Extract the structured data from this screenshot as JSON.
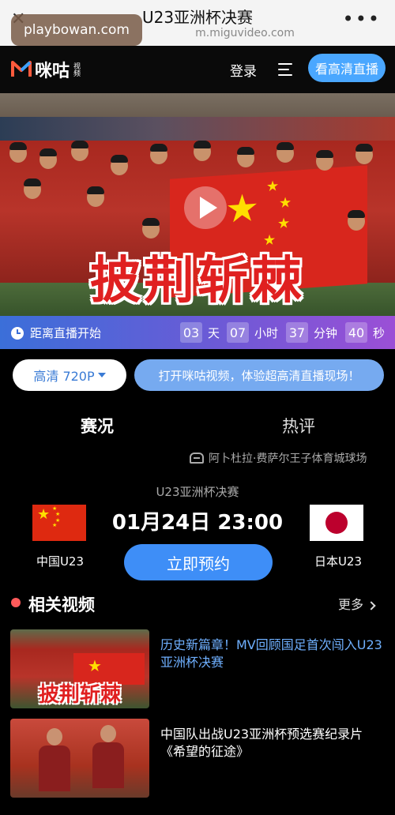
{
  "browser": {
    "title": "U23亚洲杯决赛",
    "url": "m.miguvideo.com",
    "watermark": "playbowan.com"
  },
  "header": {
    "logo_text": "咪咕",
    "logo_sub": "视频",
    "login": "登录",
    "hd_live": "看高清直播"
  },
  "hero": {
    "slogan": "披荆斩棘"
  },
  "countdown": {
    "label": "距离直播开始",
    "days": "03",
    "days_unit": "天",
    "hours": "07",
    "hours_unit": "小时",
    "minutes": "37",
    "minutes_unit": "分钟",
    "seconds": "40",
    "seconds_unit": "秒"
  },
  "quality": {
    "selected": "高清 720P",
    "open_app": "打开咪咕视频，体验超高清直播现场！"
  },
  "tabs": [
    "赛况",
    "热评"
  ],
  "match": {
    "venue": "阿卜杜拉·费萨尔王子体育城球场",
    "title": "U23亚洲杯决赛",
    "time": "01月24日 23:00",
    "home_team": "中国U23",
    "away_team": "日本U23",
    "reserve": "立即预约"
  },
  "related": {
    "title": "相关视频",
    "more": "更多",
    "videos": [
      {
        "title": "历史新篇章！MV回顾国足首次闯入U23亚洲杯决赛",
        "thumb_text": "披荆斩棘"
      },
      {
        "title": "中国队出战U23亚洲杯预选赛纪录片《希望的征途》"
      }
    ]
  },
  "colors": {
    "accent_blue": "#3e8ef7",
    "countdown_gradient_start": "#3b6fd9",
    "countdown_gradient_end": "#9b4fd6",
    "slogan_red": "#e02020",
    "related_dot": "#ff5a5a"
  }
}
